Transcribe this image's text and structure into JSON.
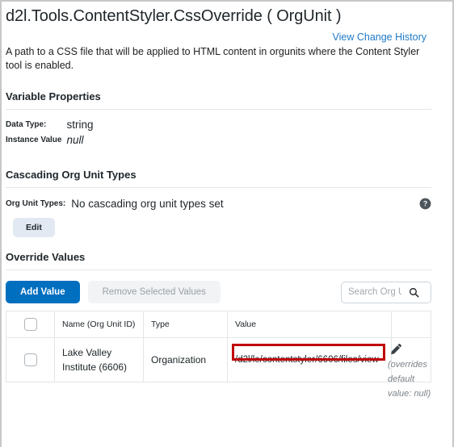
{
  "page": {
    "title": "d2l.Tools.ContentStyler.CssOverride ( OrgUnit )",
    "change_history_link": "View Change History",
    "description": "A path to a CSS file that will be applied to HTML content in orgunits where the Content Styler tool is enabled."
  },
  "variable_properties": {
    "heading": "Variable Properties",
    "rows": [
      {
        "label": "Data Type:",
        "value": "string",
        "italic": false
      },
      {
        "label": "Instance Value",
        "value": "null",
        "italic": true
      }
    ]
  },
  "cascading": {
    "heading": "Cascading Org Unit Types",
    "org_unit_types_label": "Org Unit Types:",
    "org_unit_types_value": "No cascading org unit types set",
    "help_icon": "help-circle-icon",
    "edit_label": "Edit"
  },
  "override_values": {
    "heading": "Override Values",
    "toolbar": {
      "add_value_label": "Add Value",
      "remove_selected_label": "Remove Selected Values",
      "search_placeholder": "Search Org U...",
      "search_value": "",
      "search_icon": "search-icon"
    },
    "table": {
      "columns": [
        "Name (Org Unit ID)",
        "Type",
        "Value",
        ""
      ],
      "select_all_checkbox": "unchecked",
      "rows": [
        {
          "checkbox": "unchecked",
          "name": "Lake Valley Institute (6606)",
          "type": "Organization",
          "value": "/d2l/le/contentstyler/6606/files/view",
          "edit_icon": "pencil-icon",
          "override_note": "(overrides default value: null)"
        }
      ]
    }
  },
  "annotation": {
    "highlight_color": "#c00000"
  }
}
